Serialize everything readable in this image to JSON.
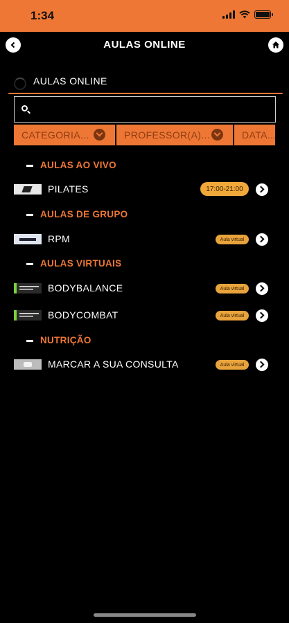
{
  "status_bar": {
    "time": "1:34"
  },
  "header": {
    "title": "AULAS ONLINE"
  },
  "section": {
    "label": "AULAS ONLINE"
  },
  "search": {
    "placeholder": "",
    "value": ""
  },
  "filters": [
    {
      "label": "CATEGORIA..."
    },
    {
      "label": "PROFESSOR(A)..."
    },
    {
      "label": "DATA..."
    }
  ],
  "groups": [
    {
      "title": "AULAS AO VIVO",
      "items": [
        {
          "label": "PILATES",
          "badge": "17:00-21:00",
          "badge_type": "time"
        }
      ]
    },
    {
      "title": "AULAS DE GRUPO",
      "items": [
        {
          "label": "RPM",
          "badge": "Aula virtual",
          "badge_type": "small"
        }
      ]
    },
    {
      "title": "AULAS VIRTUAIS",
      "items": [
        {
          "label": "BODYBALANCE",
          "badge": "Aula virtual",
          "badge_type": "small"
        },
        {
          "label": "BODYCOMBAT",
          "badge": "Aula virtual",
          "badge_type": "small"
        }
      ]
    },
    {
      "title": "NUTRIÇÃO",
      "items": [
        {
          "label": "MARCAR A SUA CONSULTA",
          "badge": "Aula virtual",
          "badge_type": "small"
        }
      ]
    }
  ],
  "colors": {
    "accent": "#ee7735",
    "badge": "#e8a33c",
    "background": "#000000"
  }
}
